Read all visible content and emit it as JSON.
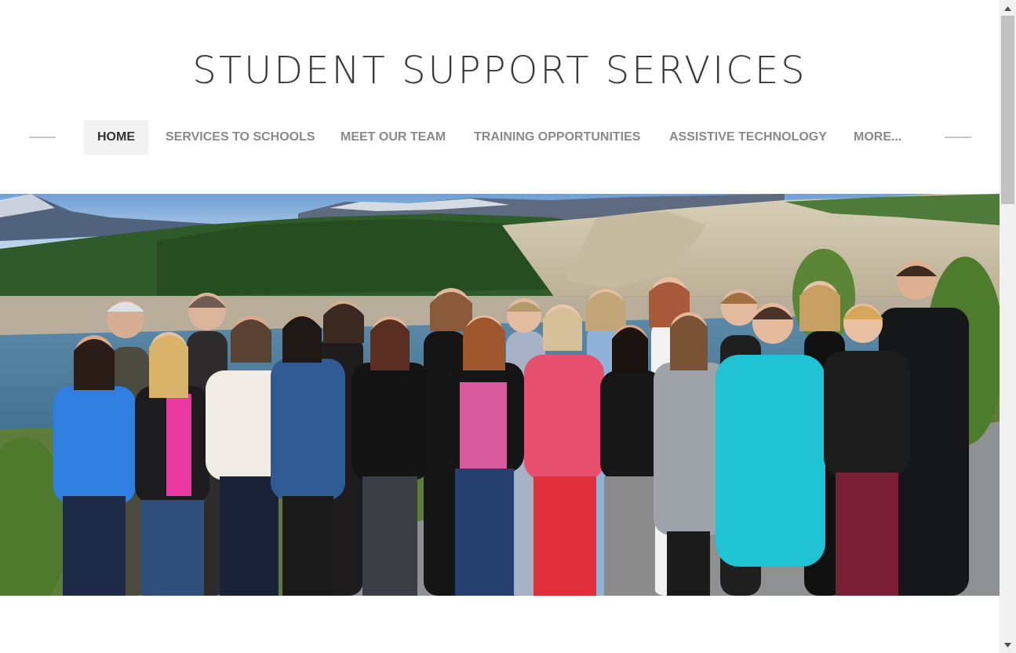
{
  "site": {
    "title": "STUDENT SUPPORT SERVICES"
  },
  "nav": {
    "items": [
      {
        "label": "HOME",
        "active": true
      },
      {
        "label": "SERVICES TO SCHOOLS",
        "active": false
      },
      {
        "label": "MEET OUR TEAM",
        "active": false
      },
      {
        "label": "TRAINING OPPORTUNITIES",
        "active": false
      },
      {
        "label": "ASSISTIVE TECHNOLOGY",
        "active": false
      },
      {
        "label": "MORE...",
        "active": false
      }
    ]
  },
  "hero": {
    "image": "team-group-photo-by-river"
  },
  "colors": {
    "title": "#3a3a3a",
    "nav_text": "#8a8a8a",
    "nav_active_text": "#333333",
    "nav_active_bg": "#f2f2f2"
  }
}
